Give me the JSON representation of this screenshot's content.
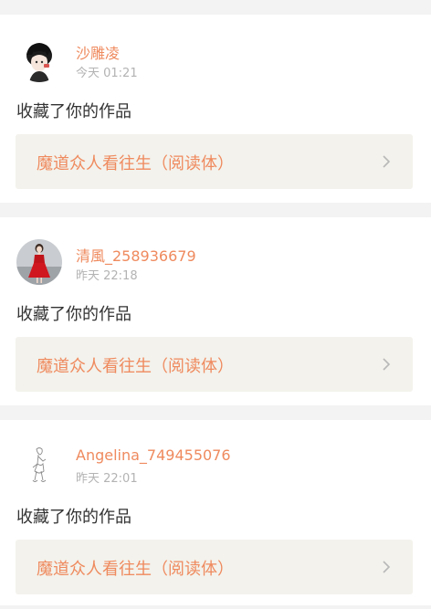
{
  "notifications": [
    {
      "username": "沙雕凌",
      "time": "今天 01:21",
      "action": "收藏了你的作品",
      "work_title": "魔道众人看往生（阅读体）",
      "avatar_icon": "anime-boy-avatar"
    },
    {
      "username": "清風_258936679",
      "time": "昨天 22:18",
      "action": "收藏了你的作品",
      "work_title": "魔道众人看往生（阅读体）",
      "avatar_icon": "red-dress-girl-avatar"
    },
    {
      "username": "Angelina_749455076",
      "time": "昨天 22:01",
      "action": "收藏了你的作品",
      "work_title": "魔道众人看往生（阅读体）",
      "avatar_icon": "sketch-figure-avatar"
    }
  ],
  "colors": {
    "accent": "#ef8a5e",
    "page_bg": "#f3f3f3",
    "card_bg": "#ffffff",
    "link_bg": "#f3f2ec",
    "timestamp": "#b3b3b3",
    "body_text": "#333333"
  }
}
